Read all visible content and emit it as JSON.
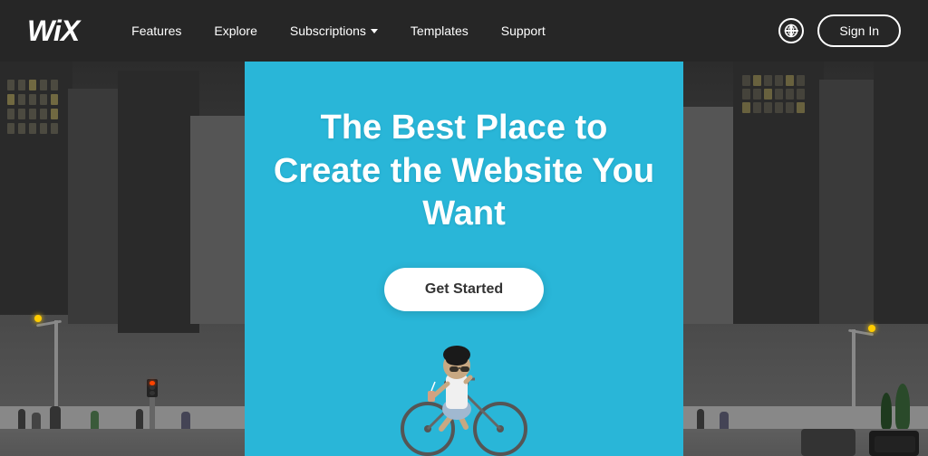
{
  "brand": {
    "logo": "WiX",
    "logo_alt": "Wix"
  },
  "navbar": {
    "links": [
      {
        "label": "Features",
        "has_dropdown": false
      },
      {
        "label": "Explore",
        "has_dropdown": false
      },
      {
        "label": "Subscriptions",
        "has_dropdown": true
      },
      {
        "label": "Templates",
        "has_dropdown": false
      },
      {
        "label": "Support",
        "has_dropdown": false
      }
    ],
    "sign_in_label": "Sign In",
    "globe_icon_name": "globe-icon"
  },
  "hero": {
    "title_line1": "The Best Place to",
    "title_line2": "Create the Website You Want",
    "cta_label": "Get Started"
  },
  "colors": {
    "navbar_bg": "rgba(20,20,20,0.92)",
    "hero_bg": "#29b6d8",
    "cta_bg": "#ffffff",
    "cta_text": "#333333"
  }
}
